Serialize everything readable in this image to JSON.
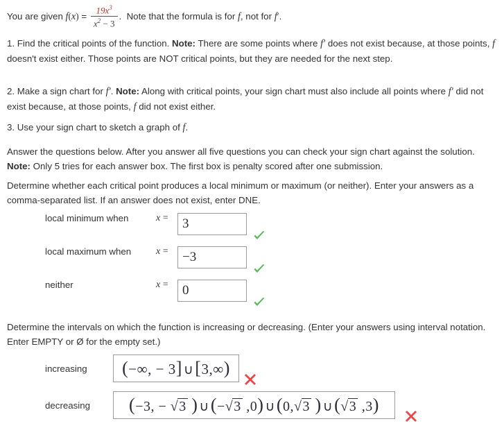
{
  "problem": {
    "intro_pre": "You are given ",
    "intro_fx": "f(x) = ",
    "formula": {
      "numerator_base": "19x",
      "numerator_exp": "3",
      "denominator_base": "x",
      "denominator_exp": "2",
      "denominator_rest": " − 3",
      "numerator_color": "#c03028"
    },
    "intro_post": ".  Note that the formula is for f, not for f′.",
    "step1": "1. Find the critical points of the function. Note: There are some points where f′ does not exist because, at those points, f doesn't exist either. Those points are NOT critical points, but they are needed for the next step.",
    "step1_parts": {
      "a": "1. Find the critical points of the function. ",
      "note": "Note:",
      "b": " There are some points where ",
      "fprime1": "f′",
      "c": " does not exist because, at those points, ",
      "f1": "f",
      "d": " doesn't exist either. Those points are NOT critical points, but they are needed for the next step."
    },
    "step2_parts": {
      "a": "2. Make a sign chart for ",
      "fprime1": "f′",
      "b": ".  ",
      "note": "Note:",
      "c": " Along with critical points, your sign chart must also include all points where ",
      "fprime2": "f′",
      "d": " did not exist because, at those points, ",
      "f1": "f",
      "e": " did not exist either."
    },
    "step3_parts": {
      "a": "3. Use your sign chart to sketch a graph of ",
      "f1": "f",
      "b": "."
    },
    "answer_intro_parts": {
      "a": "Answer the questions below. After you answer all five questions you can check your sign chart against the solution. ",
      "note": "Note:",
      "b": " Only 5 tries for each answer box. The first box is penalty scored after one submission."
    },
    "q1_prompt": "Determine whether each critical point produces a local minimum or maximum (or neither). Enter your answers as a comma-separated list. If an answer does not exist, enter DNE.",
    "q2_prompt": "Determine the intervals on which the function is increasing or decreasing. (Enter your answers using interval notation. Enter EMPTY or Ø for the empty set.)"
  },
  "critical_point_rows": [
    {
      "label": "local minimum when",
      "prefix": "x =",
      "value": "3",
      "status": "correct",
      "status_icon": "check-icon"
    },
    {
      "label": "local maximum when",
      "prefix": "x =",
      "value": "−3",
      "status": "correct",
      "status_icon": "check-icon"
    },
    {
      "label": "neither",
      "prefix": "x =",
      "value": "0",
      "status": "correct",
      "status_icon": "check-icon"
    }
  ],
  "interval_rows": [
    {
      "label": "increasing",
      "value": "(−∞, − 3] ∪ [3,∞)",
      "status": "incorrect",
      "status_icon": "cross-icon"
    },
    {
      "label": "decreasing",
      "value": "(−3, − √3 ) ∪ (−√3 ,0) ∪ (0,√3 ) ∪ (√3 ,3)",
      "status": "incorrect",
      "status_icon": "cross-icon"
    }
  ],
  "colors": {
    "text": "#333333",
    "correct": "#5cb85c",
    "incorrect": "#e8484a",
    "numerator": "#c03028",
    "box_border": "#9a9a9a"
  }
}
